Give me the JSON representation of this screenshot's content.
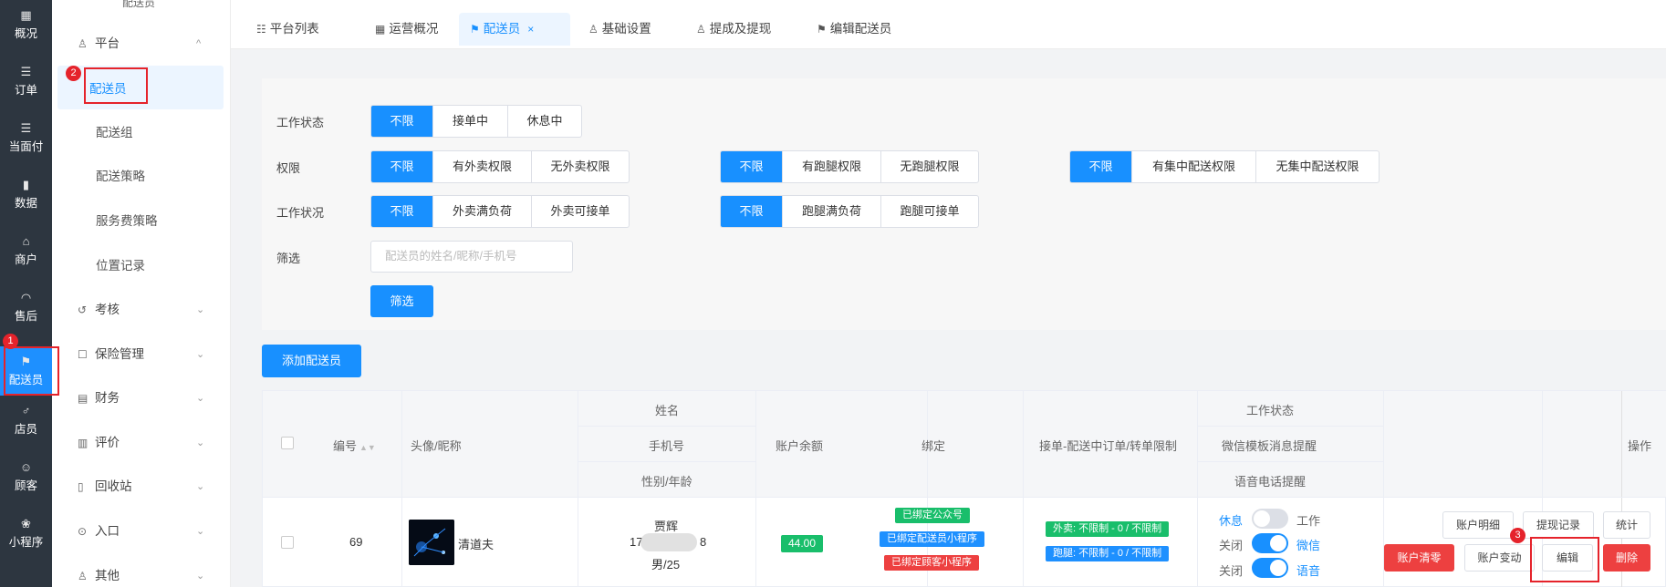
{
  "rail": {
    "items": [
      {
        "icon": "▦",
        "label": "概况"
      },
      {
        "icon": "☰",
        "label": "订单"
      },
      {
        "icon": "☰",
        "label": "当面付"
      },
      {
        "icon": "▮",
        "label": "数据"
      },
      {
        "icon": "⌂",
        "label": "商户"
      },
      {
        "icon": "◠",
        "label": "售后"
      },
      {
        "icon": "⚑",
        "label": "配送员"
      },
      {
        "icon": "♂",
        "label": "店员"
      },
      {
        "icon": "☺",
        "label": "顾客"
      },
      {
        "icon": "❀",
        "label": "小程序"
      }
    ]
  },
  "subnav": {
    "top_clip": "配送员",
    "groups": [
      {
        "icon": "♙",
        "label": "平台",
        "chevron": "^"
      },
      {
        "icon": "↺",
        "label": "考核",
        "chevron": "⌄"
      },
      {
        "icon": "☐",
        "label": "保险管理",
        "chevron": "⌄"
      },
      {
        "icon": "▤",
        "label": "财务",
        "chevron": "⌄"
      },
      {
        "icon": "▥",
        "label": "评价",
        "chevron": "⌄"
      },
      {
        "icon": "▯",
        "label": "回收站",
        "chevron": "⌄"
      },
      {
        "icon": "⊙",
        "label": "入口",
        "chevron": "⌄"
      },
      {
        "icon": "♙",
        "label": "其他",
        "chevron": "⌄"
      }
    ],
    "sub_items": [
      "配送员",
      "配送组",
      "配送策略",
      "服务费策略",
      "位置记录"
    ]
  },
  "tabs": [
    {
      "icon": "☷",
      "label": "平台列表"
    },
    {
      "icon": "▦",
      "label": "运营概况"
    },
    {
      "icon": "⚑",
      "label": "配送员",
      "close": "×"
    },
    {
      "icon": "♙",
      "label": "基础设置"
    },
    {
      "icon": "♙",
      "label": "提成及提现"
    },
    {
      "icon": "⚑",
      "label": "编辑配送员"
    }
  ],
  "filters": {
    "work_status": {
      "label": "工作状态",
      "options": [
        "不限",
        "接单中",
        "休息中"
      ]
    },
    "permission": {
      "label": "权限",
      "groups": [
        [
          "不限",
          "有外卖权限",
          "无外卖权限"
        ],
        [
          "不限",
          "有跑腿权限",
          "无跑腿权限"
        ],
        [
          "不限",
          "有集中配送权限",
          "无集中配送权限"
        ]
      ]
    },
    "work_condition": {
      "label": "工作状况",
      "groups": [
        [
          "不限",
          "外卖满负荷",
          "外卖可接单"
        ],
        [
          "不限",
          "跑腿满负荷",
          "跑腿可接单"
        ]
      ]
    },
    "search": {
      "label": "筛选",
      "placeholder": "配送员的姓名/昵称/手机号"
    },
    "filter_button": "筛选"
  },
  "add_button": "添加配送员",
  "table": {
    "headers": {
      "id": "编号",
      "avatar": "头像/昵称",
      "name": "姓名",
      "phone": "手机号",
      "gender_age": "性别/年龄",
      "balance": "账户余额",
      "binding": "绑定",
      "limits": "接单-配送中订单/转单限制",
      "work_status": "工作状态",
      "wx_template": "微信模板消息提醒",
      "voice_call": "语音电话提醒",
      "actions": "操作"
    },
    "rows": [
      {
        "id": "69",
        "nickname": "清道夫",
        "name": "贾辉",
        "phone_prefix": "17",
        "phone_suffix": "8",
        "gender_age": "男/25",
        "balance": "44.00",
        "bindings": [
          "已绑定公众号",
          "已绑定配送员小程序",
          "已绑定顾客小程序"
        ],
        "limits": [
          "外卖: 不限制 - 0 / 不限制",
          "跑腿: 不限制 - 0 / 不限制"
        ],
        "status_toggles": [
          {
            "left": "休息",
            "right": "工作",
            "on": false
          },
          {
            "left": "关闭",
            "right": "微信",
            "on": true
          },
          {
            "left": "关闭",
            "right": "语音",
            "on": true
          }
        ],
        "actions": {
          "detail": "账户明细",
          "withdraw": "提现记录",
          "stats": "统计",
          "clear": "账户清零",
          "change": "账户变动",
          "edit": "编辑",
          "delete": "删除"
        }
      }
    ]
  },
  "annotations": [
    "1",
    "2",
    "3"
  ],
  "colors": {
    "primary": "#1890ff",
    "rail_bg": "#2d3640",
    "danger": "#ed4040",
    "success": "#19be6b",
    "annotation": "#e5232b"
  }
}
